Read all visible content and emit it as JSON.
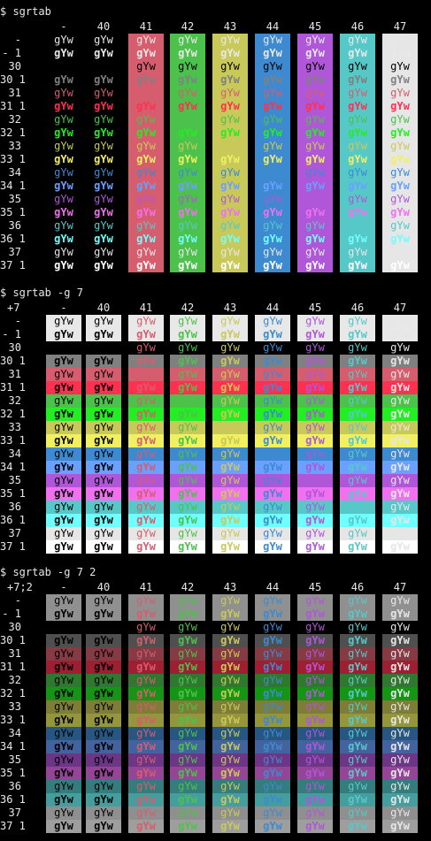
{
  "palette": {
    "def_fg": "#e8e8e8",
    "def_bg": "#000000",
    "c30": "#000000",
    "c31": "#d65d6e",
    "c32": "#4cc24c",
    "c33": "#c9c95a",
    "c34": "#3d8ad0",
    "c35": "#b056d8",
    "c36": "#56c8c8",
    "c37": "#e6e6e6",
    "b30": "#808080",
    "b31": "#ff3050",
    "b32": "#22ee22",
    "b33": "#f0f060",
    "b34": "#6aa0ff",
    "b35": "#f070f0",
    "b36": "#70ffff",
    "b37": "#ffffff",
    "col_gray_bg": "#7f7f7f",
    "row30_g": "#000000"
  },
  "sample_text": "gYw",
  "sections": [
    {
      "command": "$ sgrtab",
      "corner": "",
      "columns": [
        "-",
        "40",
        "41",
        "42",
        "43",
        "44",
        "45",
        "46",
        "47"
      ],
      "rows": [
        "-",
        "- 1",
        "30",
        "30 1",
        "31",
        "31 1",
        "32",
        "32 1",
        "33",
        "33 1",
        "34",
        "34 1",
        "35",
        "35 1",
        "36",
        "36 1",
        "37",
        "37 1"
      ]
    },
    {
      "command": "$ sgrtab -g 7",
      "corner": "+7",
      "columns": [
        "-",
        "40",
        "41",
        "42",
        "43",
        "44",
        "45",
        "46",
        "47"
      ],
      "rows": [
        "-",
        "- 1",
        "30",
        "30 1",
        "31",
        "31 1",
        "32",
        "32 1",
        "33",
        "33 1",
        "34",
        "34 1",
        "35",
        "35 1",
        "36",
        "36 1",
        "37",
        "37 1"
      ]
    },
    {
      "command": "$ sgrtab -g 7 2",
      "corner": "+7;2",
      "columns": [
        "-",
        "40",
        "41",
        "42",
        "43",
        "44",
        "45",
        "46",
        "47"
      ],
      "rows": [
        "-",
        "- 1",
        "30",
        "30 1",
        "31",
        "31 1",
        "32",
        "32 1",
        "33",
        "33 1",
        "34",
        "34 1",
        "35",
        "35 1",
        "36",
        "36 1",
        "37",
        "37 1"
      ]
    }
  ]
}
